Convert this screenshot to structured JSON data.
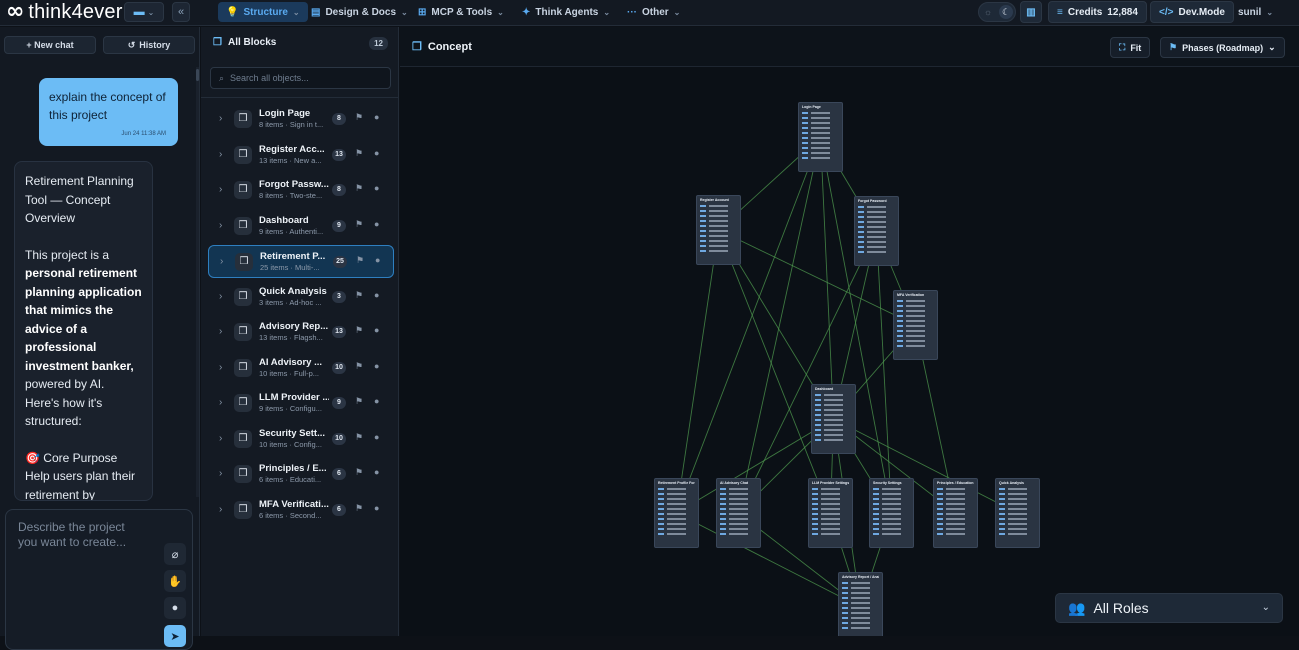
{
  "app": {
    "logo_text": "think4ever"
  },
  "topbar": {
    "menus": [
      {
        "label": "Structure",
        "icon": "💡",
        "active": true
      },
      {
        "label": "Design & Docs",
        "icon": "📄",
        "active": false
      },
      {
        "label": "MCP & Tools",
        "icon": "⚙",
        "active": false
      },
      {
        "label": "Think Agents",
        "icon": "✨",
        "active": false
      },
      {
        "label": "Other",
        "icon": "···",
        "active": false
      }
    ],
    "credits_label": "Credits",
    "credits_value": "12,884",
    "devmode_label": "Dev.Mode",
    "user_name": "sunil"
  },
  "chat": {
    "new_chat_label": "+ New chat",
    "history_label": "History",
    "user_message": "explain the concept of this project",
    "user_timestamp": "Jun 24 11:38 AM",
    "assistant_title": "Retirement Planning Tool — Concept Overview",
    "assistant_intro_1": "This project is a",
    "assistant_bold": "personal retirement planning application that mimics the advice of a professional investment banker,",
    "assistant_intro_2": "powered by AI. Here's how it's structured:",
    "assistant_section_icon": "🎯",
    "assistant_section": "Core Purpose",
    "assistant_section_text": "Help users plan their retirement by",
    "composer_placeholder": "Describe the project you want to create..."
  },
  "blocks": {
    "title": "All Blocks",
    "count": "12",
    "search_placeholder": "Search all objects...",
    "items": [
      {
        "name": "Login Page",
        "sub": "8 items · Sign in t...",
        "count": "8"
      },
      {
        "name": "Register Acc...",
        "sub": "13 items · New a...",
        "count": "13"
      },
      {
        "name": "Forgot Passw...",
        "sub": "8 items · Two-ste...",
        "count": "8"
      },
      {
        "name": "Dashboard",
        "sub": "9 items · Authenti...",
        "count": "9"
      },
      {
        "name": "Retirement P...",
        "sub": "25 items · Multi-...",
        "count": "25"
      },
      {
        "name": "Quick Analysis",
        "sub": "3 items · Ad-hoc ...",
        "count": "3"
      },
      {
        "name": "Advisory Rep...",
        "sub": "13 items · Flagsh...",
        "count": "13"
      },
      {
        "name": "AI Advisory ...",
        "sub": "10 items · Full-p...",
        "count": "10"
      },
      {
        "name": "LLM Provider ...",
        "sub": "9 items · Configu...",
        "count": "9"
      },
      {
        "name": "Security Sett...",
        "sub": "10 items · Config...",
        "count": "10"
      },
      {
        "name": "Principles / E...",
        "sub": "6 items · Educati...",
        "count": "6"
      },
      {
        "name": "MFA Verificati...",
        "sub": "6 items · Second...",
        "count": "6"
      }
    ]
  },
  "canvas": {
    "title": "Concept",
    "fit_label": "Fit",
    "phases_label": "Phases (Roadmap)",
    "roles_label": "All Roles",
    "nodes": [
      {
        "title": "Login Page"
      },
      {
        "title": "Register Account"
      },
      {
        "title": "Forgot Password"
      },
      {
        "title": "MFA Verification"
      },
      {
        "title": "Dashboard"
      },
      {
        "title": "Retirement Profile Form"
      },
      {
        "title": "AI Advisory Chat"
      },
      {
        "title": "LLM Provider Settings"
      },
      {
        "title": "Security Settings"
      },
      {
        "title": "Principles / Education"
      },
      {
        "title": "Quick Analysis"
      },
      {
        "title": "Advisory Report / Analysis"
      }
    ]
  },
  "colors": {
    "accent": "#5aaaf0",
    "user_bubble": "#6cbcf5",
    "selected_row": "#123552",
    "edge": "#4f9a4f"
  }
}
